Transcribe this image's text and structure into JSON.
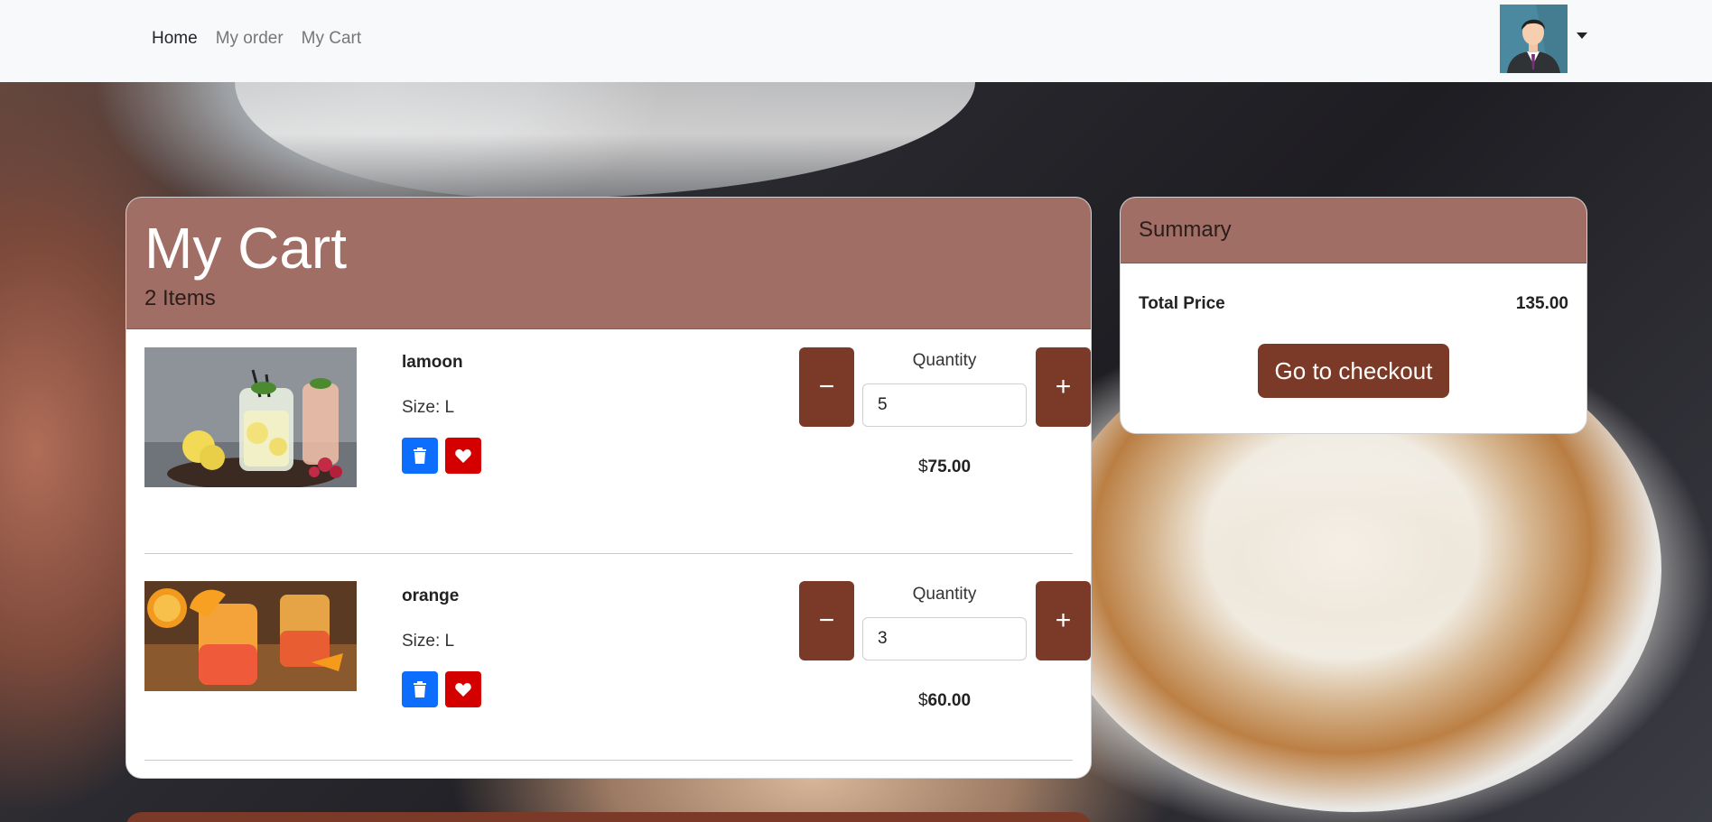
{
  "nav": {
    "links": [
      "Home",
      "My order",
      "My Cart"
    ],
    "active": "Home"
  },
  "user": {
    "avatar_icon": "user-avatar-icon"
  },
  "cart": {
    "title": "My Cart",
    "count_label": "2 Items",
    "items": [
      {
        "name": "lamoon",
        "size": "Size: L",
        "quantity_label": "Quantity",
        "quantity": "5",
        "price_currency": "$",
        "price": "75.00",
        "minus_label": "−",
        "plus_label": "+"
      },
      {
        "name": "orange",
        "size": "Size: L",
        "quantity_label": "Quantity",
        "quantity": "3",
        "price_currency": "$",
        "price": "60.00",
        "minus_label": "−",
        "plus_label": "+"
      }
    ]
  },
  "summary": {
    "title": "Summary",
    "total_label": "Total Price",
    "total_value": "135.00",
    "checkout_label": "Go to checkout"
  },
  "colors": {
    "header_brown": "#a06e64",
    "button_brown": "#7b3a27",
    "delete_blue": "#0d6efd",
    "favorite_red": "#d40000"
  }
}
